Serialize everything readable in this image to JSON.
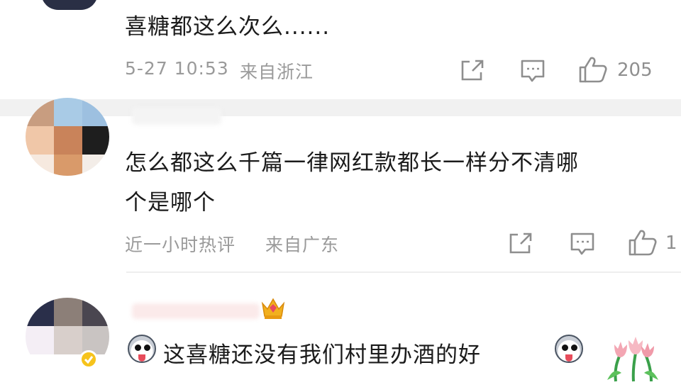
{
  "comments": [
    {
      "content": "喜糖都这么次么......",
      "time": "5-27 10:53",
      "location": "来自浙江",
      "like_count": "205",
      "icons": [
        "share-icon",
        "comment-icon",
        "thumbs-up-icon"
      ]
    },
    {
      "content_line1": "怎么都这么千篇一律网红款都长一样分不清哪",
      "content_line2": "个是哪个",
      "time": "近一小时热评",
      "location": "来自广东",
      "like_count": "1",
      "icons": [
        "share-icon",
        "comment-icon",
        "thumbs-up-icon"
      ]
    },
    {
      "content": "这喜糖还没有我们村里办酒的好",
      "icons": [
        "crown-badge-icon",
        "emoji-face-icon",
        "tulip-sticker-icon"
      ]
    }
  ],
  "colors": {
    "text": "#1b1b1b",
    "meta": "#9a9a9a",
    "divider": "#f1f1f1",
    "crown": "#f2b01e"
  }
}
